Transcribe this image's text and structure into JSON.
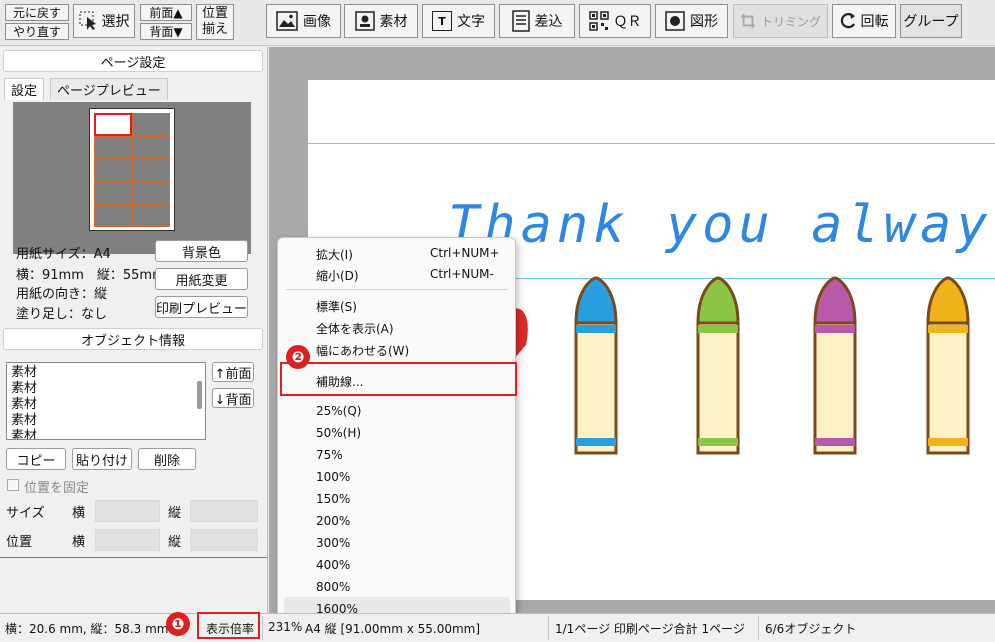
{
  "toolbar": {
    "undo": "元に戻す",
    "redo": "やり直す",
    "select": "選択",
    "front": "前面▲",
    "back": "背面▼",
    "align1": "位置",
    "align2": "揃え",
    "image": "画像",
    "material": "素材",
    "text": "文字",
    "insert": "差込",
    "qr": "ＱＲ",
    "shape": "図形",
    "trim": "トリミング",
    "rotate": "回転",
    "group": "グループ"
  },
  "page_settings": {
    "header": "ページ設定",
    "tab_settings": "設定",
    "tab_preview": "ページプレビュー",
    "paper_size": "用紙サイズ：A4",
    "dimensions": "横：91mm　縦：55mm",
    "orientation": "用紙の向き：縦",
    "bleed": "塗り足し：なし",
    "btn_background": "背景色",
    "btn_change_paper": "用紙変更",
    "btn_print_preview": "印刷プレビュー"
  },
  "object_info": {
    "header": "オブジェクト情報",
    "items": [
      "素材",
      "素材",
      "素材",
      "素材",
      "素材"
    ],
    "btn_front": "↑前面",
    "btn_back": "↓背面",
    "btn_copy": "コピー",
    "btn_paste": "貼り付け",
    "btn_delete": "削除",
    "lock_label": "位置を固定",
    "size_label": "サイズ",
    "position_label": "位置",
    "horizontal": "横",
    "vertical": "縦"
  },
  "canvas": {
    "headline": "Thank you always"
  },
  "context_menu": {
    "group1": [
      {
        "label": "拡大(I)",
        "shortcut": "Ctrl+NUM+"
      },
      {
        "label": "縮小(D)",
        "shortcut": "Ctrl+NUM-"
      }
    ],
    "group2": [
      {
        "label": "標準(S)"
      },
      {
        "label": "全体を表示(A)"
      },
      {
        "label": "幅にあわせる(W)"
      }
    ],
    "group3": [
      {
        "label": "補助線..."
      }
    ],
    "zoom_levels": [
      "25%(Q)",
      "50%(H)",
      "75%",
      "100%",
      "150%",
      "200%",
      "300%",
      "400%",
      "800%",
      "1600%"
    ]
  },
  "callouts": {
    "one": "❶",
    "two": "❷"
  },
  "status": {
    "coords": "横：20.6 mm, 縦：58.3 mm",
    "zoom_label": "表示倍率",
    "zoom_value": "231%",
    "paper": "A4 縦 [91.00mm x 55.00mm]",
    "pages": "1/1ページ 印刷ページ合計 1ページ",
    "objects": "6/6オブジェクト"
  },
  "crayon_colors": [
    "#2a9fe0",
    "#8cc443",
    "#b85aa7",
    "#efb41a"
  ],
  "accent_red": "#e02020"
}
